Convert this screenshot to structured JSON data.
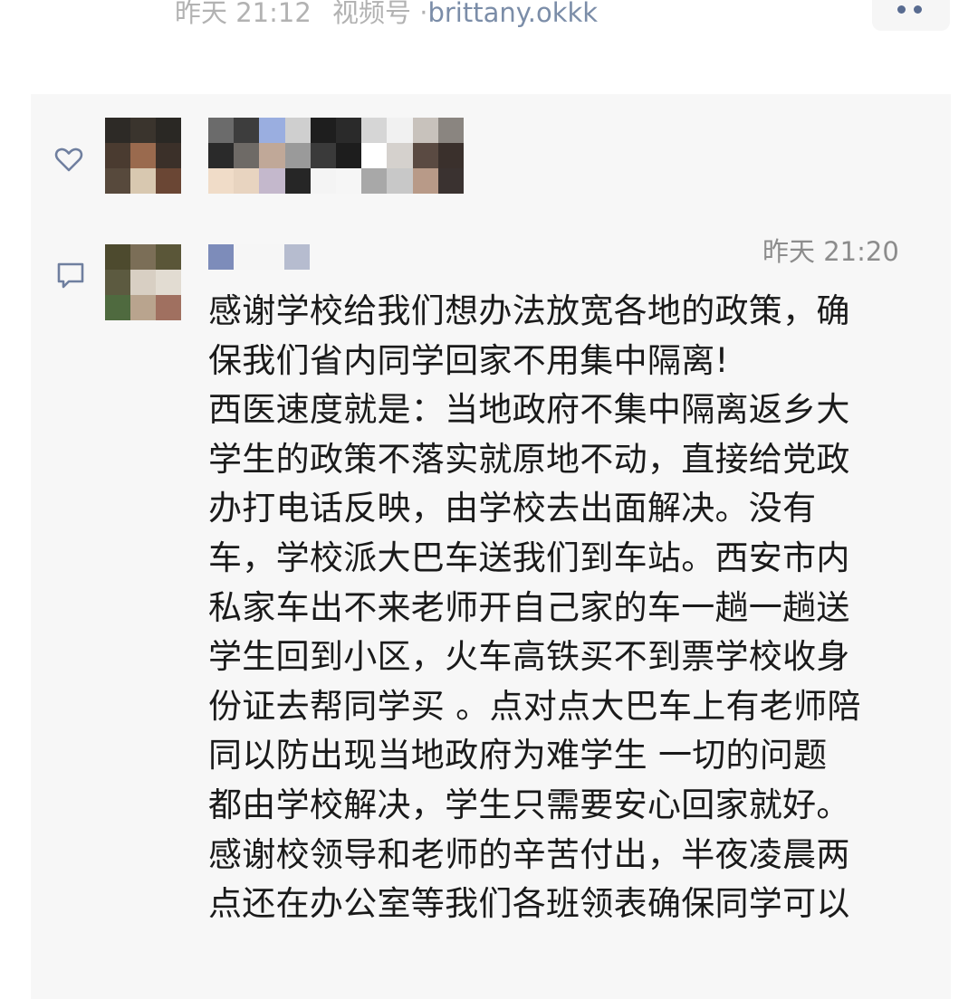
{
  "post_meta": {
    "time": "昨天 21:12",
    "source_prefix": "视频号 · ",
    "source_account": "brittany.okkk"
  },
  "icons": {
    "more": "more-dots-icon",
    "like": "heart-outline-icon",
    "comment": "comment-bubble-icon"
  },
  "colors": {
    "meta_text": "#b2b2b2",
    "link": "#7b8da8",
    "panel_bg": "#f7f7f7",
    "icon": "#6f7f9f",
    "body_text": "#1a1a1a"
  },
  "comment": {
    "time": "昨天 21:20",
    "lines": [
      "感谢学校给我们想办法放宽各地的政策，确",
      "保我们省内同学回家不用集中隔离!",
      "西医速度就是：当地政府不集中隔离返乡大",
      "学生的政策不落实就原地不动，直接给党政",
      "办打电话反映，由学校去出面解决。没有",
      "车，学校派大巴车送我们到车站。西安市内",
      "私家车出不来老师开自己家的车一趟一趟送",
      "学生回到小区，火车高铁买不到票学校收身",
      "份证去帮同学买 。点对点大巴车上有老师陪",
      "同以防出现当地政府为难学生 一切的问题",
      "都由学校解决，学生只需要安心回家就好。",
      "感谢校领导和老师的辛苦付出，半夜凌晨两",
      "点还在办公室等我们各班领表确保同学可以"
    ]
  }
}
